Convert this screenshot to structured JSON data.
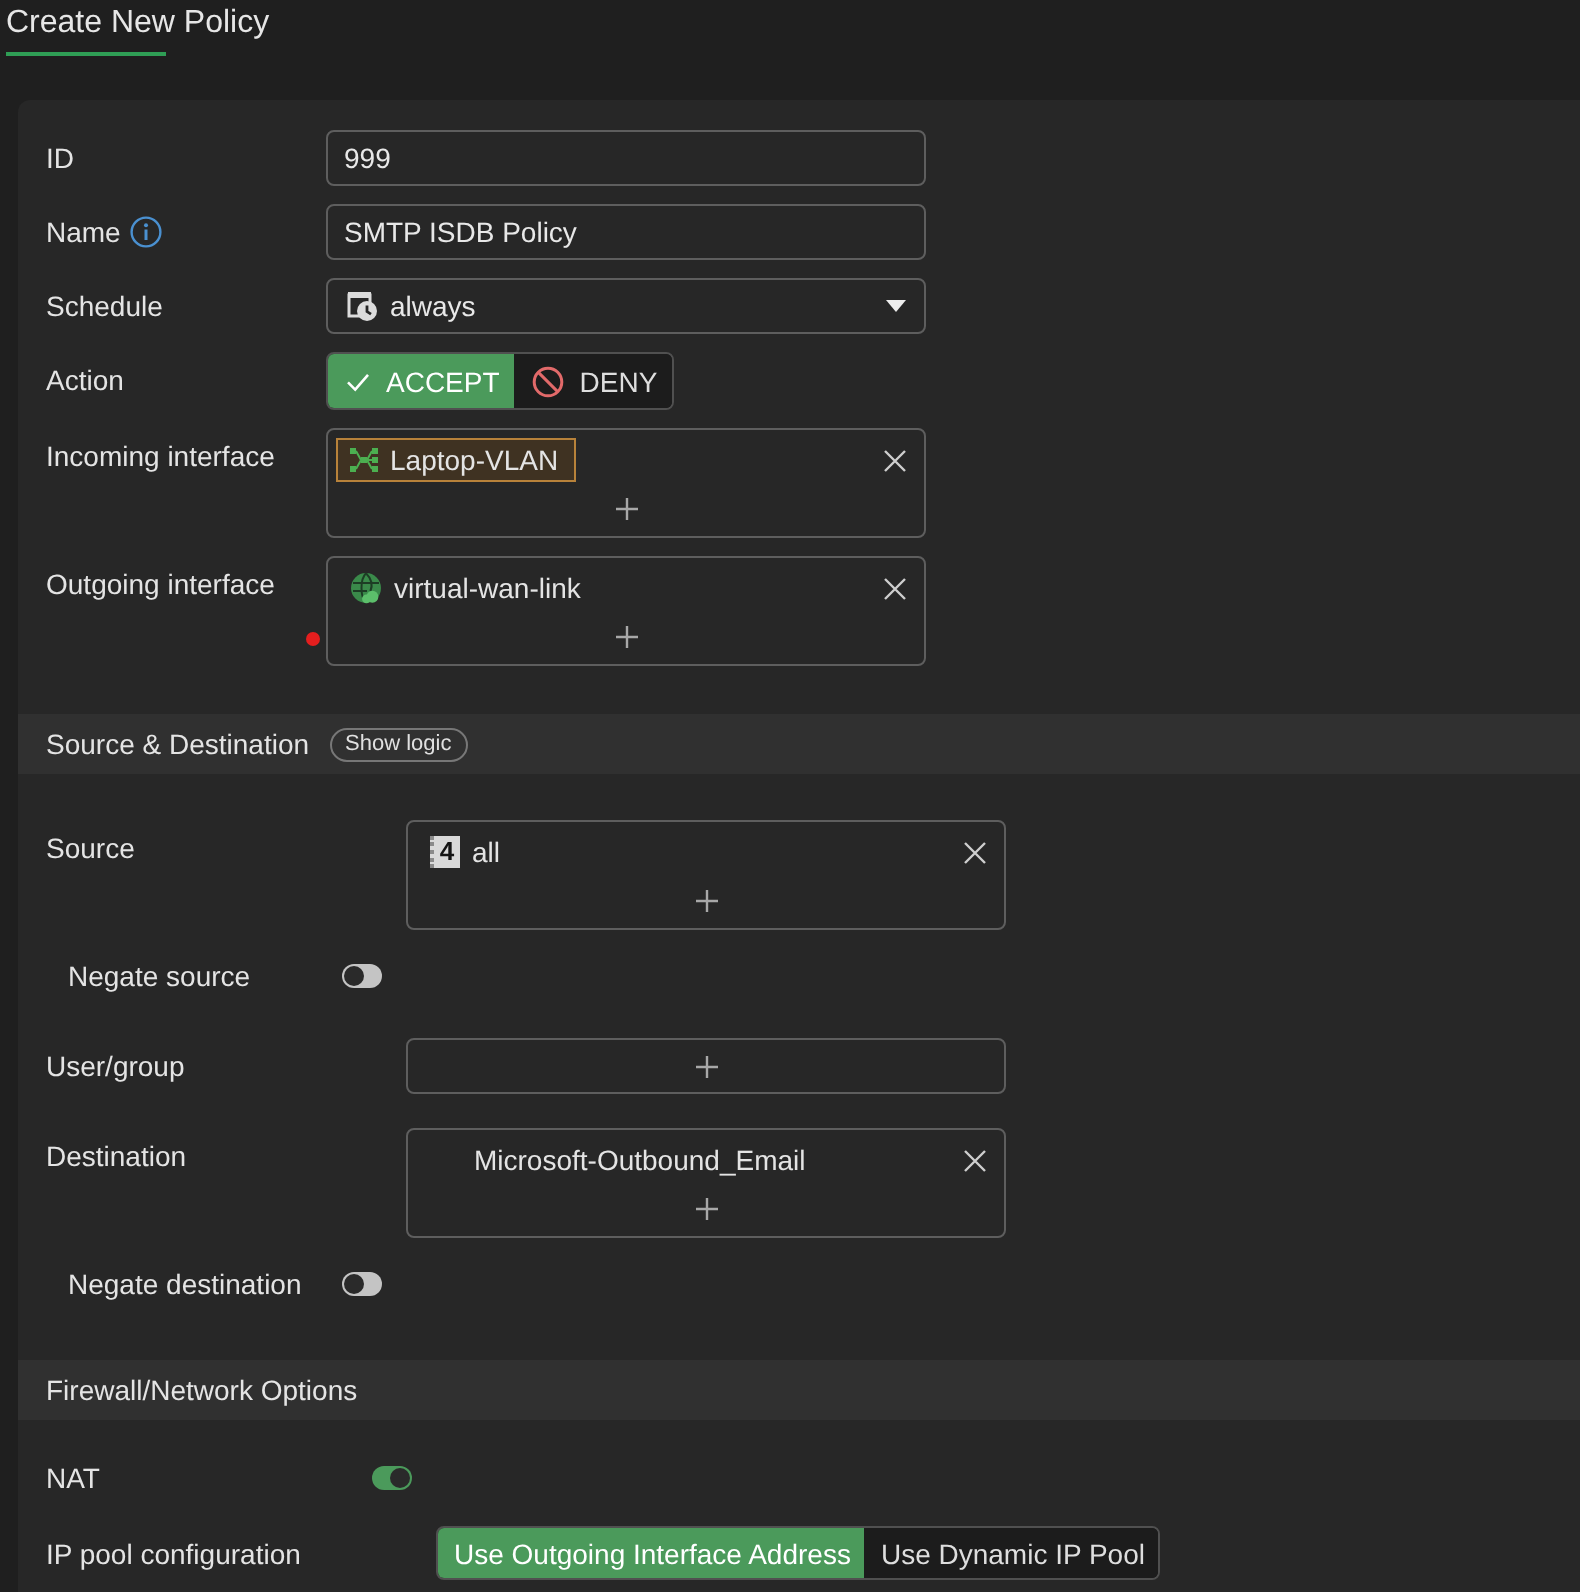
{
  "header": {
    "title": "Create New Policy"
  },
  "general": {
    "rows": [
      {
        "kind": "text",
        "label": "ID",
        "value": "999"
      },
      {
        "kind": "text",
        "label": "Name",
        "value": "SMTP ISDB Policy",
        "info": true
      },
      {
        "kind": "select",
        "label": "Schedule",
        "value": "always"
      },
      {
        "kind": "segmented",
        "label": "Action",
        "options": [
          {
            "kind": "accept",
            "label": "ACCEPT",
            "selected": true
          },
          {
            "kind": "deny",
            "label": "DENY",
            "selected": false
          }
        ]
      },
      {
        "kind": "multi",
        "label": "Incoming interface",
        "flagged": false,
        "items": [
          {
            "kind": "interface",
            "label": "Laptop-VLAN",
            "selected": true
          }
        ]
      },
      {
        "kind": "multi",
        "label": "Outgoing interface",
        "flagged": true,
        "items": [
          {
            "kind": "sdwan",
            "label": "virtual-wan-link",
            "selected": false
          }
        ]
      }
    ]
  },
  "sections": [
    {
      "title": "Source & Destination",
      "button": "Show logic",
      "rows": [
        {
          "kind": "multi",
          "label": "Source",
          "items": [
            {
              "kind": "address",
              "badge": "4",
              "label": "all",
              "selected": false
            }
          ]
        },
        {
          "kind": "toggle",
          "label": "Negate source",
          "on": false
        },
        {
          "kind": "multi",
          "label": "User/group"
        },
        {
          "kind": "multi",
          "label": "Destination",
          "items": [
            {
              "kind": "isdb",
              "label": "Microsoft-Outbound_Email",
              "selected": false
            }
          ]
        },
        {
          "kind": "toggle",
          "label": "Negate destination",
          "on": false
        }
      ]
    },
    {
      "title": "Firewall/Network Options",
      "rows": [
        {
          "kind": "toggle",
          "label": "NAT",
          "on": true
        },
        {
          "kind": "segmented",
          "label": "IP pool configuration",
          "options": [
            {
              "label": "Use Outgoing Interface Address",
              "selected": true
            },
            {
              "label": "Use Dynamic IP Pool",
              "selected": false
            }
          ]
        }
      ]
    }
  ]
}
